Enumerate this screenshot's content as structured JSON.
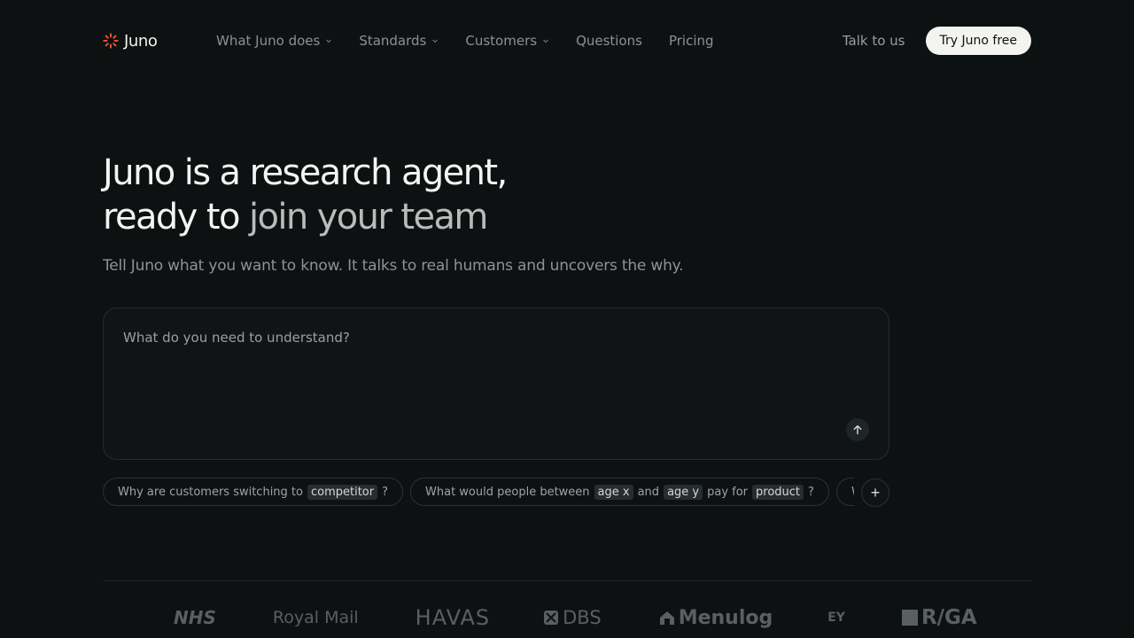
{
  "brand": {
    "name": "Juno",
    "accent": "#e5532d"
  },
  "nav": {
    "links": [
      {
        "label": "What Juno does",
        "dropdown": true
      },
      {
        "label": "Standards",
        "dropdown": true
      },
      {
        "label": "Customers",
        "dropdown": true
      },
      {
        "label": "Questions",
        "dropdown": false
      },
      {
        "label": "Pricing",
        "dropdown": false
      }
    ],
    "talk_label": "Talk to us",
    "cta_label": "Try Juno free"
  },
  "hero": {
    "line1": "Juno is a research agent,",
    "line2_a": "ready to ",
    "line2_b": "join your team",
    "subtitle": "Tell Juno what you want to know. It talks to real humans and uncovers the why."
  },
  "input": {
    "placeholder": "What do you need to understand?"
  },
  "chips": {
    "c1": {
      "text1": "Why are customers switching to",
      "token1": "competitor",
      "end": "?"
    },
    "c2": {
      "text1": "What would people between",
      "token1": "age x",
      "text2": "and",
      "token2": "age y",
      "text3": "pay for",
      "token3": "product",
      "end": "?"
    },
    "c3": {
      "text1": "W"
    }
  },
  "logos": {
    "nhs": "NHS",
    "royal_mail": "Royal Mail",
    "havas": "HAVAS",
    "dbs": "DBS",
    "menulog": "Menulog",
    "ey": "EY",
    "rga": "R/GA"
  }
}
